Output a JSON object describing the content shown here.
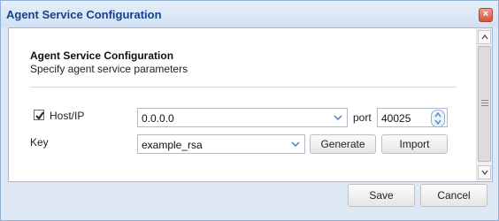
{
  "window": {
    "title": "Agent Service Configuration",
    "close_icon": "close-icon"
  },
  "form": {
    "title": "Agent Service Configuration",
    "subtitle": "Specify agent service parameters",
    "host": {
      "checked": true,
      "label": "Host/IP",
      "value": "0.0.0.0"
    },
    "port": {
      "label": "port",
      "value": "40025"
    },
    "key": {
      "label": "Key",
      "value": "example_rsa"
    },
    "generate_label": "Generate",
    "import_label": "Import"
  },
  "footer": {
    "save_label": "Save",
    "cancel_label": "Cancel"
  },
  "colors": {
    "title_text": "#15428b",
    "border_accent": "#99bbe8",
    "close_button": "#d0563d"
  }
}
